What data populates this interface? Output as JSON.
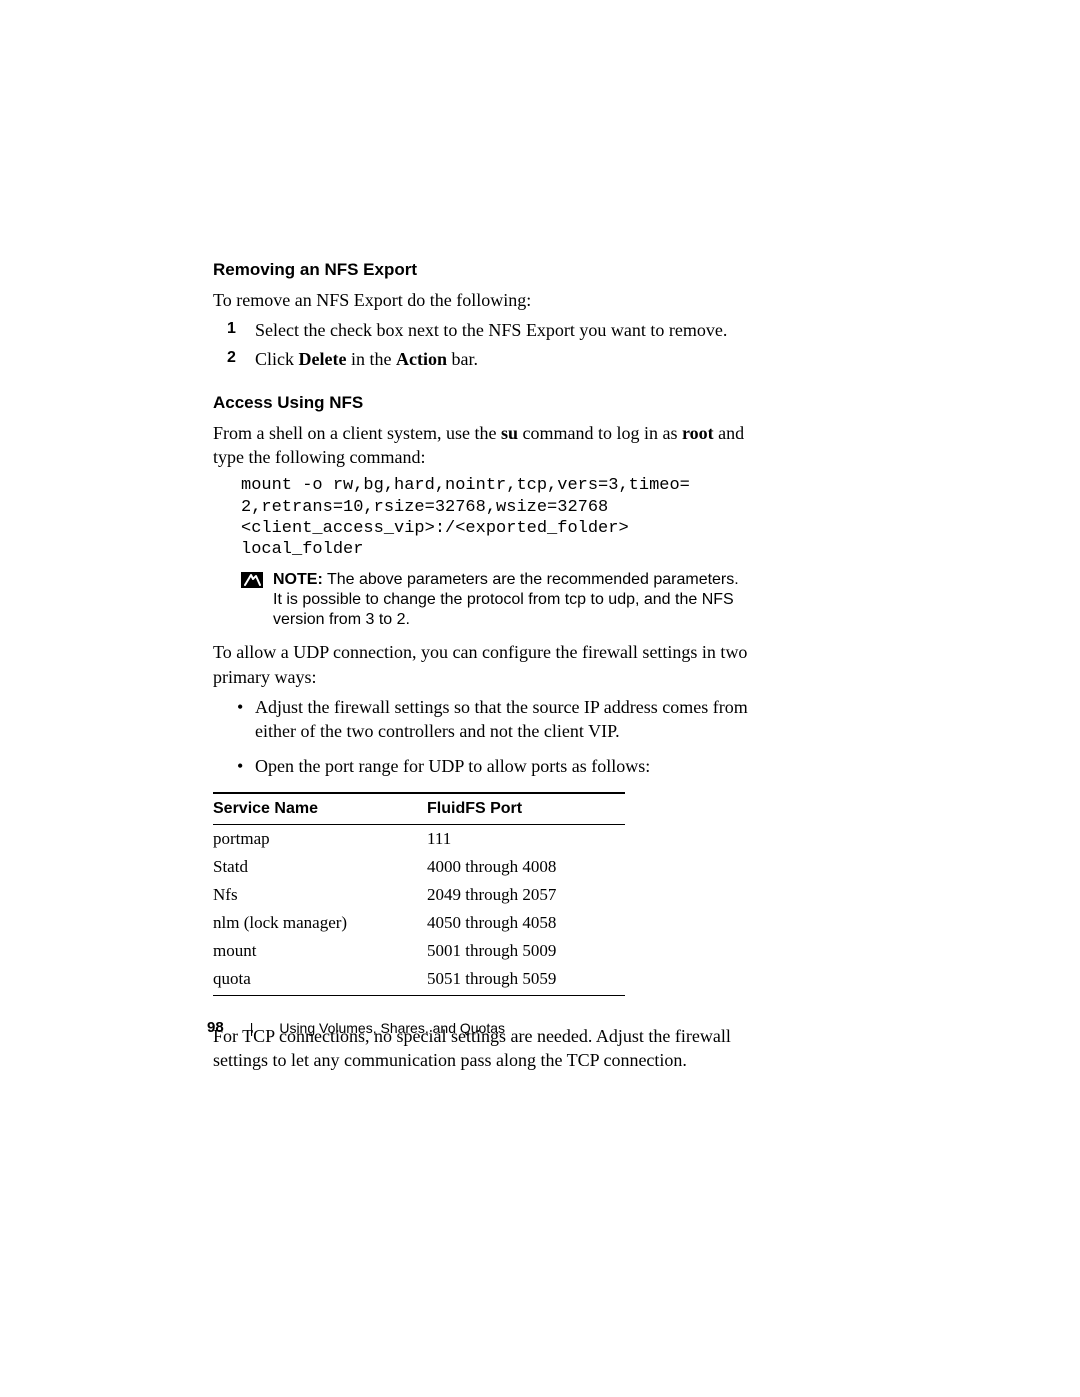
{
  "sections": {
    "removing": {
      "heading": "Removing an NFS Export",
      "intro": "To remove an NFS Export do the following:",
      "steps": [
        {
          "n": "1",
          "text_pre": "Select the check box next to the NFS Export you want to remove."
        },
        {
          "n": "2",
          "text_pre": "Click ",
          "b1": "Delete",
          "mid": " in the ",
          "b2": "Action",
          "post": " bar."
        }
      ]
    },
    "access": {
      "heading": "Access Using NFS",
      "intro_pre": "From a shell on a client system, use the ",
      "intro_b1": "su",
      "intro_mid": " command to log in as ",
      "intro_b2": "root",
      "intro_post": " and type the following command:",
      "code": "mount -o rw,bg,hard,nointr,tcp,vers=3,timeo=\n2,retrans=10,rsize=32768,wsize=32768\n<client_access_vip>:/<exported_folder>\nlocal_folder",
      "note_label": "NOTE:",
      "note_text": " The above parameters are the recommended parameters. It is possible to change the protocol from tcp to udp, and the NFS version from 3 to 2.",
      "udp_intro": "To allow a UDP connection, you can configure the firewall settings in two primary ways:",
      "bullets": [
        "Adjust the firewall settings so that the source IP address comes from either of the two controllers and not the client VIP.",
        "Open the port range for UDP to allow ports as follows:"
      ],
      "table": {
        "headers": [
          "Service Name",
          "FluidFS Port"
        ],
        "rows": [
          [
            "portmap",
            "111"
          ],
          [
            "Statd",
            "4000 through 4008"
          ],
          [
            "Nfs",
            "2049 through 2057"
          ],
          [
            "nlm (lock manager)",
            "4050 through 4058"
          ],
          [
            "mount",
            "5001 through 5009"
          ],
          [
            "quota",
            "5051 through 5059"
          ]
        ]
      },
      "tcp_para": "For TCP connections, no special settings are needed. Adjust the firewall settings to let any communication pass along the TCP connection."
    }
  },
  "footer": {
    "page_number": "98",
    "separator": "|",
    "section_title": "Using Volumes, Shares, and Quotas"
  }
}
